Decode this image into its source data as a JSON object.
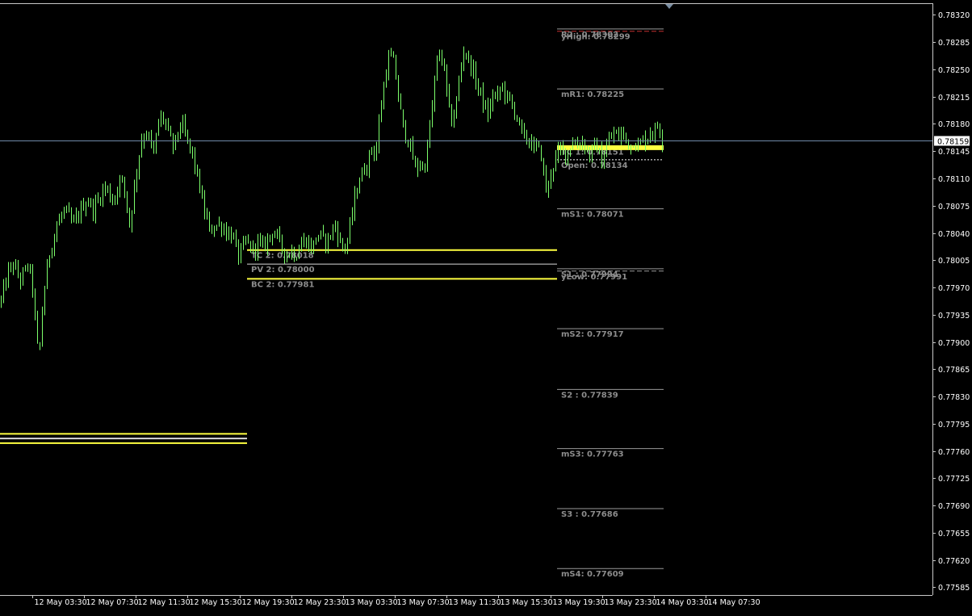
{
  "chart_data": {
    "type": "candlestick",
    "current_price": "0.78159",
    "y_axis_ticks": [
      "0.78320",
      "0.78285",
      "0.78250",
      "0.78215",
      "0.78180",
      "0.78145",
      "0.78110",
      "0.78075",
      "0.78040",
      "0.78005",
      "0.77970",
      "0.77935",
      "0.77900",
      "0.77865",
      "0.77830",
      "0.77795",
      "0.77760",
      "0.77725",
      "0.77690",
      "0.77655",
      "0.77620",
      "0.77585"
    ],
    "x_axis_ticks": [
      "12 May 03:30",
      "12 May 07:30",
      "12 May 11:30",
      "12 May 15:30",
      "12 May 19:30",
      "12 May 23:30",
      "13 May 03:30",
      "13 May 07:30",
      "13 May 11:30",
      "13 May 15:30",
      "13 May 19:30",
      "13 May 23:30",
      "14 May 03:30",
      "14 May 07:30"
    ],
    "ylim": [
      0.77575,
      0.78335
    ],
    "price_path": [
      [
        0,
        0.7795
      ],
      [
        5,
        0.7797
      ],
      [
        10,
        0.7799
      ],
      [
        15,
        0.78
      ],
      [
        20,
        0.7799
      ],
      [
        25,
        0.7798
      ],
      [
        30,
        0.7799
      ],
      [
        35,
        0.78
      ],
      [
        40,
        0.7797
      ],
      [
        45,
        0.779
      ],
      [
        48,
        0.7788
      ],
      [
        52,
        0.7794
      ],
      [
        56,
        0.7798
      ],
      [
        60,
        0.7801
      ],
      [
        65,
        0.7803
      ],
      [
        70,
        0.7805
      ],
      [
        75,
        0.7806
      ],
      [
        80,
        0.7807
      ],
      [
        85,
        0.7806
      ],
      [
        90,
        0.7805
      ],
      [
        95,
        0.7806
      ],
      [
        100,
        0.7807
      ],
      [
        105,
        0.7808
      ],
      [
        110,
        0.7808
      ],
      [
        115,
        0.7807
      ],
      [
        120,
        0.7808
      ],
      [
        125,
        0.7809
      ],
      [
        130,
        0.781
      ],
      [
        135,
        0.7809
      ],
      [
        140,
        0.7808
      ],
      [
        145,
        0.781
      ],
      [
        150,
        0.7811
      ],
      [
        155,
        0.7809
      ],
      [
        160,
        0.7805
      ],
      [
        165,
        0.7809
      ],
      [
        170,
        0.7813
      ],
      [
        175,
        0.7816
      ],
      [
        180,
        0.7817
      ],
      [
        185,
        0.7816
      ],
      [
        190,
        0.7814
      ],
      [
        195,
        0.7818
      ],
      [
        200,
        0.7819
      ],
      [
        205,
        0.7818
      ],
      [
        210,
        0.7816
      ],
      [
        215,
        0.7815
      ],
      [
        220,
        0.7817
      ],
      [
        225,
        0.7818
      ],
      [
        230,
        0.7816
      ],
      [
        235,
        0.7815
      ],
      [
        240,
        0.7813
      ],
      [
        245,
        0.7811
      ],
      [
        250,
        0.7808
      ],
      [
        255,
        0.7806
      ],
      [
        260,
        0.7804
      ],
      [
        265,
        0.7805
      ],
      [
        270,
        0.7805
      ],
      [
        275,
        0.7805
      ],
      [
        280,
        0.7804
      ],
      [
        285,
        0.7804
      ],
      [
        290,
        0.7803
      ],
      [
        295,
        0.7801
      ],
      [
        300,
        0.7802
      ],
      [
        305,
        0.7803
      ],
      [
        310,
        0.7802
      ],
      [
        315,
        0.7802
      ],
      [
        320,
        0.7803
      ],
      [
        325,
        0.7802
      ],
      [
        330,
        0.7803
      ],
      [
        335,
        0.7804
      ],
      [
        340,
        0.7804
      ],
      [
        345,
        0.7803
      ],
      [
        350,
        0.7802
      ],
      [
        355,
        0.7801
      ],
      [
        360,
        0.7802
      ],
      [
        365,
        0.7801
      ],
      [
        370,
        0.7802
      ],
      [
        375,
        0.7803
      ],
      [
        380,
        0.7803
      ],
      [
        385,
        0.7802
      ],
      [
        390,
        0.7803
      ],
      [
        395,
        0.7804
      ],
      [
        400,
        0.7803
      ],
      [
        405,
        0.7803
      ],
      [
        410,
        0.7804
      ],
      [
        415,
        0.7805
      ],
      [
        420,
        0.7803
      ],
      [
        425,
        0.7802
      ],
      [
        430,
        0.7803
      ],
      [
        435,
        0.7806
      ],
      [
        440,
        0.7809
      ],
      [
        445,
        0.7811
      ],
      [
        450,
        0.7812
      ],
      [
        455,
        0.7813
      ],
      [
        460,
        0.7815
      ],
      [
        465,
        0.7814
      ],
      [
        470,
        0.7819
      ],
      [
        475,
        0.7823
      ],
      [
        480,
        0.7826
      ],
      [
        485,
        0.7827
      ],
      [
        490,
        0.7824
      ],
      [
        495,
        0.782
      ],
      [
        500,
        0.7817
      ],
      [
        505,
        0.7816
      ],
      [
        510,
        0.7814
      ],
      [
        515,
        0.7812
      ],
      [
        520,
        0.7813
      ],
      [
        525,
        0.7812
      ],
      [
        530,
        0.7816
      ],
      [
        535,
        0.782
      ],
      [
        540,
        0.7826
      ],
      [
        545,
        0.7827
      ],
      [
        550,
        0.7825
      ],
      [
        555,
        0.782
      ],
      [
        560,
        0.7818
      ],
      [
        565,
        0.7821
      ],
      [
        570,
        0.7825
      ],
      [
        575,
        0.7828
      ],
      [
        580,
        0.7826
      ],
      [
        585,
        0.7825
      ],
      [
        590,
        0.7823
      ],
      [
        595,
        0.7822
      ],
      [
        600,
        0.782
      ],
      [
        605,
        0.7819
      ],
      [
        610,
        0.7822
      ],
      [
        615,
        0.7821
      ],
      [
        620,
        0.7823
      ],
      [
        625,
        0.7822
      ],
      [
        630,
        0.7821
      ],
      [
        635,
        0.782
      ],
      [
        640,
        0.7819
      ],
      [
        645,
        0.7817
      ],
      [
        650,
        0.7816
      ],
      [
        655,
        0.7816
      ],
      [
        660,
        0.7815
      ],
      [
        665,
        0.7815
      ],
      [
        670,
        0.7814
      ],
      [
        675,
        0.781
      ],
      [
        678,
        0.7809
      ],
      [
        682,
        0.7812
      ],
      [
        686,
        0.7813
      ],
      [
        690,
        0.7814
      ],
      [
        695,
        0.7815
      ],
      [
        700,
        0.7814
      ],
      [
        705,
        0.7815
      ],
      [
        710,
        0.7816
      ],
      [
        715,
        0.7815
      ],
      [
        720,
        0.7816
      ],
      [
        725,
        0.7815
      ],
      [
        730,
        0.7814
      ],
      [
        735,
        0.7815
      ],
      [
        740,
        0.7815
      ],
      [
        745,
        0.7813
      ],
      [
        750,
        0.7815
      ],
      [
        755,
        0.7816
      ],
      [
        760,
        0.7817
      ],
      [
        765,
        0.7816
      ],
      [
        770,
        0.7817
      ],
      [
        775,
        0.7816
      ],
      [
        780,
        0.7815
      ],
      [
        785,
        0.7816
      ],
      [
        790,
        0.7815
      ],
      [
        795,
        0.7816
      ],
      [
        800,
        0.7816
      ],
      [
        805,
        0.7817
      ],
      [
        810,
        0.7817
      ],
      [
        815,
        0.7818
      ],
      [
        820,
        0.7816
      ]
    ],
    "levels": [
      {
        "label": "yHigh: 0.78299",
        "price": 0.78299,
        "style": "dash",
        "color": "#c23030",
        "anchor": "right_zone"
      },
      {
        "label": "R2 : 0.78302",
        "price": 0.78302,
        "style": "solid",
        "color": "#9a9a9a",
        "anchor": "right_zone"
      },
      {
        "label": "mR1: 0.78225",
        "price": 0.78225,
        "style": "solid",
        "color": "#9a9a9a",
        "anchor": "right_zone"
      },
      {
        "label": "Open: 0.78134",
        "price": 0.78134,
        "style": "dot",
        "color": "#ffffff",
        "anchor": "right_zone"
      },
      {
        "label": "mS1: 0.78071",
        "price": 0.78071,
        "style": "solid",
        "color": "#9a9a9a",
        "anchor": "right_zone"
      },
      {
        "label": "S1 : 0.77994",
        "price": 0.77994,
        "style": "solid",
        "color": "#9a9a9a",
        "anchor": "right_zone"
      },
      {
        "label": "yLow: 0.77991",
        "price": 0.77991,
        "style": "dash",
        "color": "#9a9a9a",
        "anchor": "right_zone"
      },
      {
        "label": "mS2: 0.77917",
        "price": 0.77917,
        "style": "solid",
        "color": "#9a9a9a",
        "anchor": "right_zone"
      },
      {
        "label": "S2 : 0.77839",
        "price": 0.77839,
        "style": "solid",
        "color": "#9a9a9a",
        "anchor": "right_zone"
      },
      {
        "label": "mS3: 0.77763",
        "price": 0.77763,
        "style": "solid",
        "color": "#9a9a9a",
        "anchor": "right_zone"
      },
      {
        "label": "S3 : 0.77686",
        "price": 0.77686,
        "style": "solid",
        "color": "#9a9a9a",
        "anchor": "right_zone"
      },
      {
        "label": "mS4: 0.77609",
        "price": 0.77609,
        "style": "solid",
        "color": "#9a9a9a",
        "anchor": "right_zone"
      },
      {
        "label": "TC 2: 0.78018",
        "price": 0.78018,
        "style": "solid",
        "color": "#ffff40",
        "anchor": "mid_zone"
      },
      {
        "label": "PV 2: 0.78000",
        "price": 0.78,
        "style": "solid",
        "color": "#d8d8d8",
        "anchor": "mid_zone"
      },
      {
        "label": "BC 2: 0.77981",
        "price": 0.77981,
        "style": "solid",
        "color": "#ffff40",
        "anchor": "mid_zone"
      },
      {
        "label": "TC 1: 0.78151",
        "price": 0.78151,
        "style": "thick",
        "color": "#ffff40",
        "anchor": "right_zone"
      },
      {
        "label": "",
        "price": 0.78148,
        "style": "thick",
        "color": "#ffff40",
        "anchor": "right_zone"
      },
      {
        "label": "",
        "price": 0.77782,
        "style": "solid",
        "color": "#ffff40",
        "anchor": "left_zone"
      },
      {
        "label": "",
        "price": 0.77776,
        "style": "solid",
        "color": "#d8d8d8",
        "anchor": "left_zone"
      },
      {
        "label": "",
        "price": 0.7777,
        "style": "solid",
        "color": "#ffff40",
        "anchor": "left_zone"
      }
    ],
    "colors": {
      "background": "#000000",
      "candles": "#7cff6b",
      "frame": "#c8c8c8",
      "axis_text": "#ffffff",
      "level_label": "#8c8c8c",
      "current_line": "#6f8aa8"
    },
    "grid": false
  }
}
